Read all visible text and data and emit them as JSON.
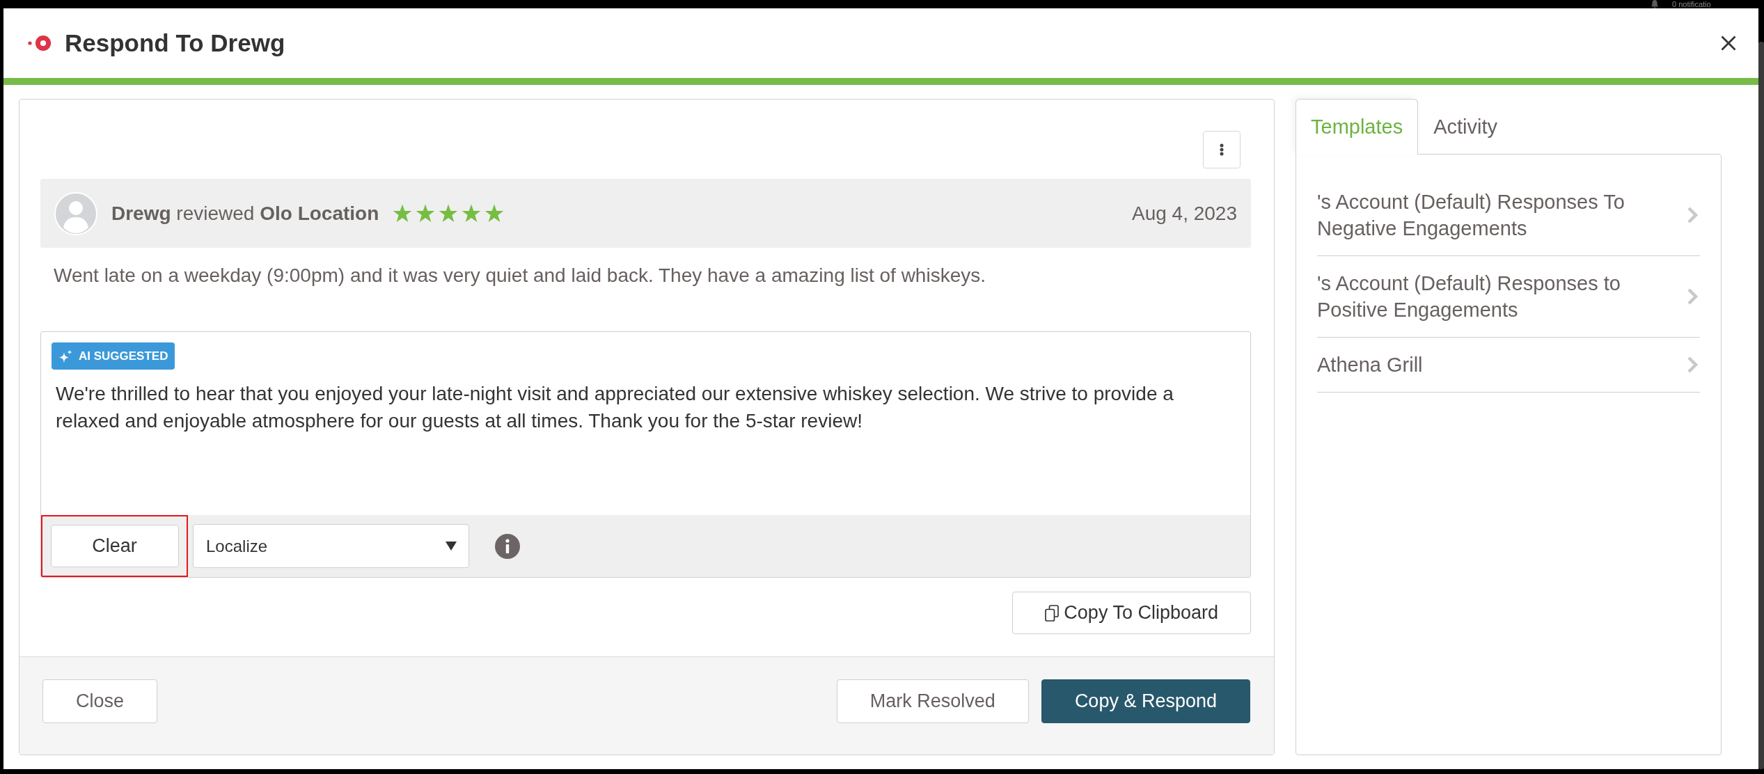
{
  "notifications": {
    "label": "0 notificatio"
  },
  "modal": {
    "title": "Respond To Drewg",
    "review": {
      "heading": "**Drewg** reviewed **Olo Location**",
      "stars": 5,
      "date": "Aug 4, 2023",
      "text": "Went late on a weekday (9:00pm) and it was very quiet and laid back. They have a amazing list of whiskeys."
    },
    "response": {
      "badge": "AI SUGGESTED",
      "value": "We're thrilled to hear that you enjoyed your late-night visit and appreciated our extensive whiskey selection. We strive to provide a relaxed and enjoyable atmosphere for our guests at all times. Thank you for the 5-star review!",
      "clear_button": {
        "label": "Clear",
        "highlighted": true
      },
      "localize_select": {
        "value": "Localize"
      },
      "copy_button": "Copy To Clipboard"
    },
    "footer": {
      "buttons": [
        {
          "label": "Close",
          "kind": "default"
        },
        {
          "label": "Mark Resolved",
          "kind": "default"
        },
        {
          "label": "Copy & Respond",
          "kind": "primary"
        }
      ]
    },
    "side_panel": {
      "tabs": [
        {
          "label": "Templates",
          "selected": true
        },
        {
          "label": "Activity",
          "selected": false
        }
      ],
      "templates": [
        "'s Account (Default) Responses To Negative Engagements",
        "'s Account (Default) Responses to Positive Engagements",
        "Athena Grill"
      ]
    }
  }
}
